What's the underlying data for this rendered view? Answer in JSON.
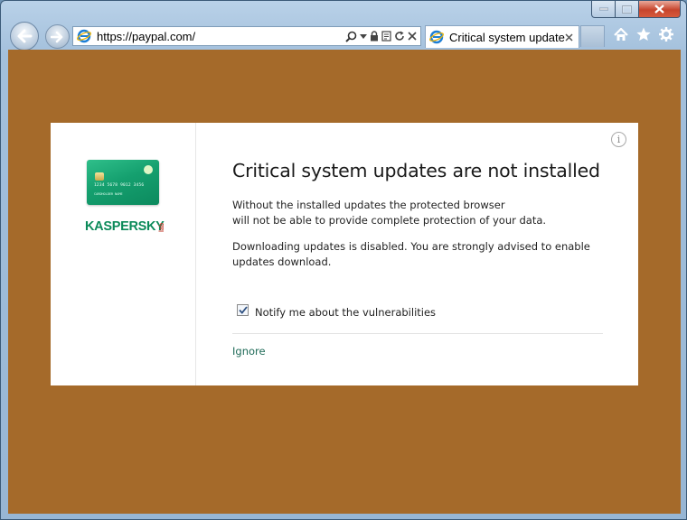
{
  "browser": {
    "address": "https://paypal.com/",
    "tab_title": "Critical system update..."
  },
  "dialog": {
    "brand": "KASPERSKY",
    "brand_suffix": "lab",
    "card_number": "1234 5678 9012 3456",
    "card_holder": "CARDHOLDER NAME",
    "title": "Critical system updates are not installed",
    "paragraph1_line1": "Without the installed updates the protected browser",
    "paragraph1_line2": "will not be able to provide complete protection of your data.",
    "paragraph2_line1": "Downloading updates is disabled. You are strongly advised to enable",
    "paragraph2_line2": "updates download.",
    "checkbox_label": "Notify me about the vulnerabilities",
    "checkbox_checked": true,
    "ignore_link": "Ignore"
  },
  "colors": {
    "page_background": "#a56a2a",
    "brand_green": "#0b8a59",
    "link_color": "#1e6a57"
  }
}
